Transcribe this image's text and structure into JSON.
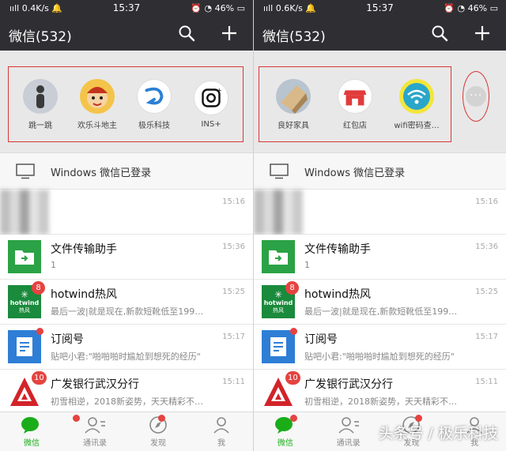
{
  "status_bar": {
    "signal": "ııll",
    "speed_left": "0.4K/s",
    "speed_right": "0.6K/s",
    "time": "15:37",
    "battery": "46%"
  },
  "header": {
    "title": "微信(532)"
  },
  "panel_left": {
    "apps": [
      {
        "label": "跳一跳",
        "icon": "jump-person-icon"
      },
      {
        "label": "欢乐斗地主",
        "icon": "landlord-game-icon"
      },
      {
        "label": "极乐科技",
        "icon": "jile-logo-icon"
      },
      {
        "label": "INS+",
        "icon": "instagram-icon"
      }
    ]
  },
  "panel_right": {
    "apps": [
      {
        "label": "良好家具",
        "icon": "furniture-icon"
      },
      {
        "label": "红包店",
        "icon": "shop-icon"
      },
      {
        "label": "wifi密码查…",
        "icon": "wifi-icon"
      }
    ],
    "more": "···"
  },
  "login_bar": {
    "text": "Windows 微信已登录"
  },
  "chats": [
    {
      "name": "",
      "preview": "",
      "time": "15:16",
      "badge": ""
    },
    {
      "name": "文件传输助手",
      "preview": "1",
      "time": "15:36",
      "badge": ""
    },
    {
      "name": "hotwind热风",
      "preview": "最后一波|就是现在,新款短靴低至199…",
      "time": "15:25",
      "badge": "8"
    },
    {
      "name": "订阅号",
      "preview": "贴吧小君:\"啪啪啪时尴尬到想死的经历\"",
      "time": "15:17",
      "badge": ""
    },
    {
      "name": "广发银行武汉分行",
      "preview": "初雪相逆，2018新姿势，天天精彩不…",
      "time": "15:11",
      "badge": "10"
    }
  ],
  "hotwind_logo": {
    "line1": "hotwind",
    "line2": "热风"
  },
  "tabs": [
    {
      "label": "微信"
    },
    {
      "label": "通讯录"
    },
    {
      "label": "发现"
    },
    {
      "label": "我"
    }
  ],
  "watermark": "头条号 / 极乐科技",
  "colors": {
    "accent": "#1aad19",
    "badge": "#e64340",
    "header": "#2f2f33"
  }
}
